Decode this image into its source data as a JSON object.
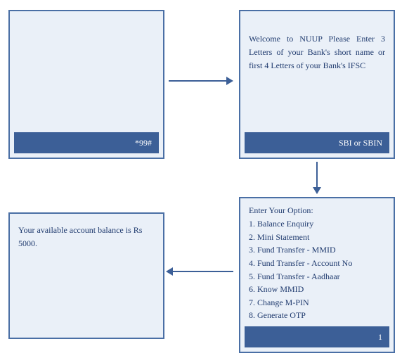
{
  "step1": {
    "footer": "*99#"
  },
  "step2": {
    "message": "Welcome to NUUP Please Enter 3 Letters of your Bank's short name or first 4 Letters of your Bank's IFSC",
    "footer": "SBI or SBIN"
  },
  "step3": {
    "heading": "Enter Your Option:",
    "options": [
      "1. Balance Enquiry",
      "2. Mini Statement",
      "3. Fund Transfer - MMID",
      "4. Fund Transfer - Account No",
      "5. Fund Transfer - Aadhaar",
      "6. Know MMID",
      "7. Change M-PIN",
      "8. Generate OTP"
    ],
    "footer": "1"
  },
  "step4": {
    "message": "Your available account balance is Rs 5000."
  }
}
